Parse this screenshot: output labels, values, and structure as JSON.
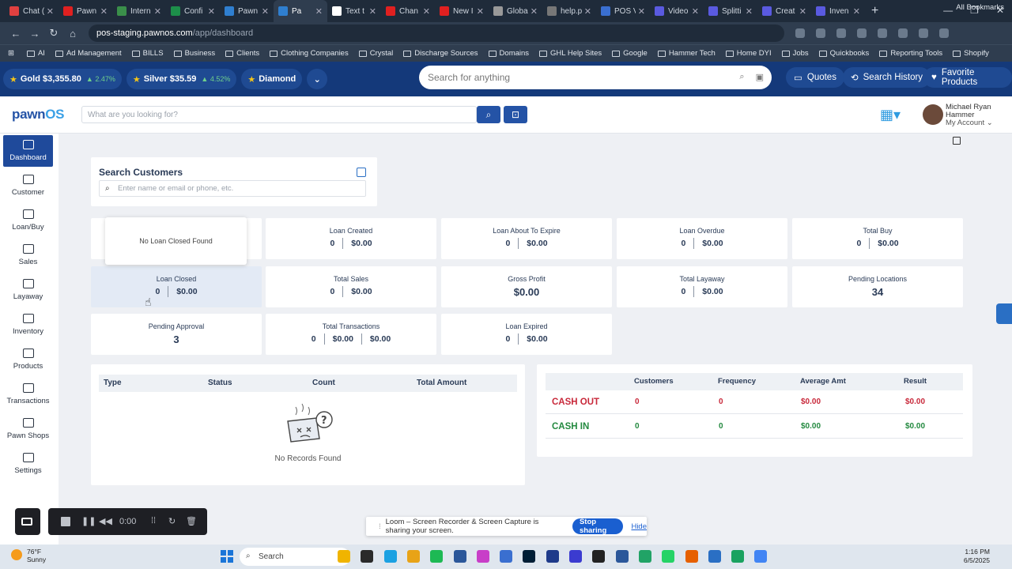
{
  "browser": {
    "tabs": [
      {
        "title": "Chat (",
        "color": "#e04040"
      },
      {
        "title": "Pawn",
        "color": "#e02020"
      },
      {
        "title": "Intern",
        "color": "#3a8f4a"
      },
      {
        "title": "Confi",
        "color": "#1d8f4a"
      },
      {
        "title": "Pawn",
        "color": "#2f7fd0"
      },
      {
        "title": "Pa",
        "color": "#2f7fd0"
      },
      {
        "title": "Text t",
        "color": "#ffffff"
      },
      {
        "title": "Chan",
        "color": "#e02020"
      },
      {
        "title": "New I",
        "color": "#e02020"
      },
      {
        "title": "Globa",
        "color": "#999999"
      },
      {
        "title": "help.p",
        "color": "#777777"
      },
      {
        "title": "POS V",
        "color": "#3a6fd0"
      },
      {
        "title": "Video",
        "color": "#5a5ae0"
      },
      {
        "title": "Splitti",
        "color": "#5a5ae0"
      },
      {
        "title": "Creat",
        "color": "#5a5ae0"
      },
      {
        "title": "Inven",
        "color": "#5a5ae0"
      }
    ],
    "url_host": "pos-staging.pawnos.com",
    "url_path": "/app/dashboard",
    "bookmarks": [
      "AI",
      "Ad Management",
      "BILLS",
      "Business",
      "Clients",
      "Clothing Companies",
      "Crystal",
      "Discharge Sources",
      "Domains",
      "GHL Help Sites",
      "Google",
      "Hammer Tech",
      "Home DYI",
      "Jobs",
      "Quickbooks",
      "Reporting Tools",
      "Shopify"
    ],
    "all_bookmarks": "All Bookmarks"
  },
  "ticker": {
    "gold_label": "Gold $3,355.80",
    "gold_change": "▲ 2.47%",
    "silver_label": "Silver $35.59",
    "silver_change": "▲ 4.52%",
    "diamond_label": "Diamond",
    "search_placeholder": "Search for anything",
    "quotes": "Quotes",
    "search_history": "Search History",
    "favorite_products": "Favorite Products"
  },
  "header": {
    "logo_a": "pawn",
    "logo_b": "OS",
    "search_placeholder": "What are you looking for?",
    "user_name_1": "Michael Ryan",
    "user_name_2": "Hammer",
    "user_account": "My Account"
  },
  "sidebar": {
    "items": [
      {
        "label": "Dashboard"
      },
      {
        "label": "Customer"
      },
      {
        "label": "Loan/Buy"
      },
      {
        "label": "Sales"
      },
      {
        "label": "Layaway"
      },
      {
        "label": "Inventory"
      },
      {
        "label": "Products"
      },
      {
        "label": "Transactions"
      },
      {
        "label": "Pawn Shops"
      },
      {
        "label": "Settings"
      }
    ]
  },
  "search_customers": {
    "title": "Search Customers",
    "placeholder": "Enter name or email or phone, etc."
  },
  "stats": {
    "popup": "No Loan Closed Found",
    "loan_created": {
      "label": "Loan Created",
      "count": "0",
      "amount": "$0.00"
    },
    "loan_expire": {
      "label": "Loan About To Expire",
      "count": "0",
      "amount": "$0.00"
    },
    "loan_overdue": {
      "label": "Loan Overdue",
      "count": "0",
      "amount": "$0.00"
    },
    "total_buy": {
      "label": "Total Buy",
      "count": "0",
      "amount": "$0.00"
    },
    "loan_closed": {
      "label": "Loan Closed",
      "count": "0",
      "amount": "$0.00"
    },
    "total_sales": {
      "label": "Total Sales",
      "count": "0",
      "amount": "$0.00"
    },
    "gross_profit": {
      "label": "Gross Profit",
      "amount": "$0.00"
    },
    "total_layaway": {
      "label": "Total Layaway",
      "count": "0",
      "amount": "$0.00"
    },
    "pending_locations": {
      "label": "Pending Locations",
      "value": "34"
    },
    "pending_approval": {
      "label": "Pending Approval",
      "value": "3"
    },
    "total_transactions": {
      "label": "Total Transactions",
      "count": "0",
      "amount1": "$0.00",
      "amount2": "$0.00"
    },
    "loan_expired": {
      "label": "Loan Expired",
      "count": "0",
      "amount": "$0.00"
    }
  },
  "records_table": {
    "headers": [
      "Type",
      "Status",
      "Count",
      "Total Amount"
    ],
    "empty": "No Records Found"
  },
  "cash_table": {
    "headers": [
      "Customers",
      "Frequency",
      "Average Amt",
      "Result"
    ],
    "rows": [
      {
        "name": "CASH OUT",
        "customers": "0",
        "frequency": "0",
        "average": "$0.00",
        "result": "$0.00"
      },
      {
        "name": "CASH IN",
        "customers": "0",
        "frequency": "0",
        "average": "$0.00",
        "result": "$0.00"
      }
    ]
  },
  "loom": {
    "time": "0:00",
    "share_text": "Loom – Screen Recorder & Screen Capture is sharing your screen.",
    "stop_sharing": "Stop sharing",
    "hide": "Hide"
  },
  "taskbar": {
    "temp": "76°F",
    "condition": "Sunny",
    "search": "Search",
    "time": "1:16 PM",
    "date": "6/5/2025"
  }
}
